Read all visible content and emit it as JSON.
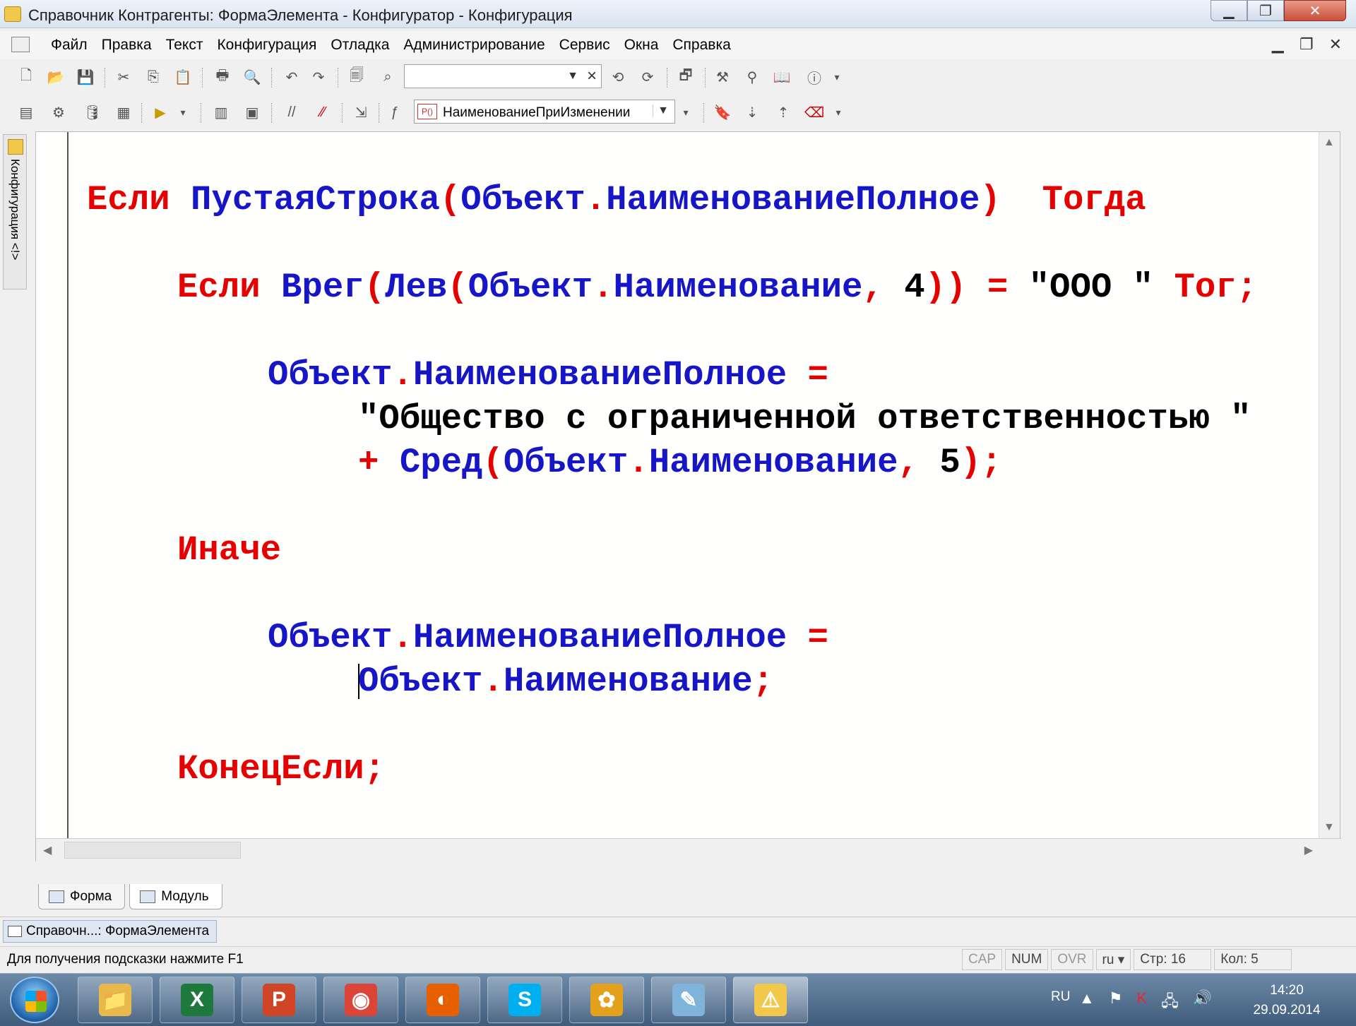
{
  "window": {
    "title": "Справочник Контрагенты: ФормаЭлемента - Конфигуратор - Конфигурация",
    "controls": {
      "minimize": "▁",
      "maximize": "❐",
      "close": "✕"
    }
  },
  "menu": {
    "items": [
      "Файл",
      "Правка",
      "Текст",
      "Конфигурация",
      "Отладка",
      "Администрирование",
      "Сервис",
      "Окна",
      "Справка"
    ],
    "mdi_controls": {
      "minimize": "▁",
      "restore": "❐",
      "close": "✕"
    }
  },
  "toolbar1": {
    "search_value": "",
    "search_placeholder": ""
  },
  "toolbar2": {
    "procedure_badge": "P()",
    "procedure_value": "НаименованиеПриИзменении"
  },
  "left_panel": {
    "label": "Конфигурация <!>"
  },
  "editor": {
    "lines": {
      "l1": {
        "kw1": "Если",
        "fn": "ПустаяСтрока",
        "p1": "(",
        "obj": "Объект",
        "dot": ".",
        "prop": "НаименованиеПолное",
        "p2": ")",
        "kw2": "Тогда"
      },
      "l2": {
        "kw1": "Если",
        "fn1": "Врег",
        "p1": "(",
        "fn2": "Лев",
        "p2": "(",
        "obj": "Объект",
        "dot": ".",
        "prop": "Наименование",
        "comma": ",",
        "num": "4",
        "p3": "))",
        "eq": "=",
        "str": "\"ООО \"",
        "kw2": "Тог;"
      },
      "l3": {
        "obj": "Объект",
        "dot": ".",
        "prop": "НаименованиеПолное",
        "eq": "="
      },
      "l4": {
        "str": "\"Общество с ограниченной ответственностью \""
      },
      "l5": {
        "plus": "+",
        "fn": "Сред",
        "p1": "(",
        "obj": "Объект",
        "dot": ".",
        "prop": "Наименование",
        "comma": ",",
        "num": "5",
        "p2": ")",
        "semi": ";"
      },
      "l6": {
        "kw": "Иначе"
      },
      "l7": {
        "obj": "Объект",
        "dot": ".",
        "prop": "НаименованиеПолное",
        "eq": "="
      },
      "l8": {
        "obj": "Объект",
        "dot": ".",
        "prop": "Наименование",
        "semi": ";"
      },
      "l9": {
        "kw": "КонецЕсли",
        "semi": ";"
      }
    },
    "colors": {
      "keyword": "#e60000",
      "identifier": "#1616c8",
      "literal": "#000000"
    }
  },
  "editor_tabs": [
    {
      "label": "Форма",
      "active": false
    },
    {
      "label": "Модуль",
      "active": true
    }
  ],
  "window_tabs": [
    {
      "label": "Справочн...: ФормаЭлемента"
    }
  ],
  "statusbar": {
    "hint": "Для получения подсказки нажмите F1",
    "cap": "CAP",
    "num": "NUM",
    "ovr": "OVR",
    "lang": "ru ▾",
    "line": "Стр: 16",
    "col": "Кол: 5"
  },
  "taskbar": {
    "apps": [
      {
        "name": "explorer-icon",
        "glyph": "📁",
        "color": "#e8b94a"
      },
      {
        "name": "excel-icon",
        "glyph": "X",
        "color": "#1e7a3c"
      },
      {
        "name": "powerpoint-icon",
        "glyph": "P",
        "color": "#d04525"
      },
      {
        "name": "chrome-icon",
        "glyph": "◉",
        "color": "#db4437"
      },
      {
        "name": "firefox-icon",
        "glyph": "◐",
        "color": "#e66000"
      },
      {
        "name": "skype-icon",
        "glyph": "S",
        "color": "#00aff0"
      },
      {
        "name": "icq-icon",
        "glyph": "✿",
        "color": "#e3a21a"
      },
      {
        "name": "notepad-icon",
        "glyph": "✎",
        "color": "#7fb3d9"
      },
      {
        "name": "1c-icon",
        "glyph": "⚠",
        "color": "#f2c84b"
      }
    ],
    "tray": {
      "lang": "RU",
      "time": "14:20",
      "date": "29.09.2014"
    }
  }
}
